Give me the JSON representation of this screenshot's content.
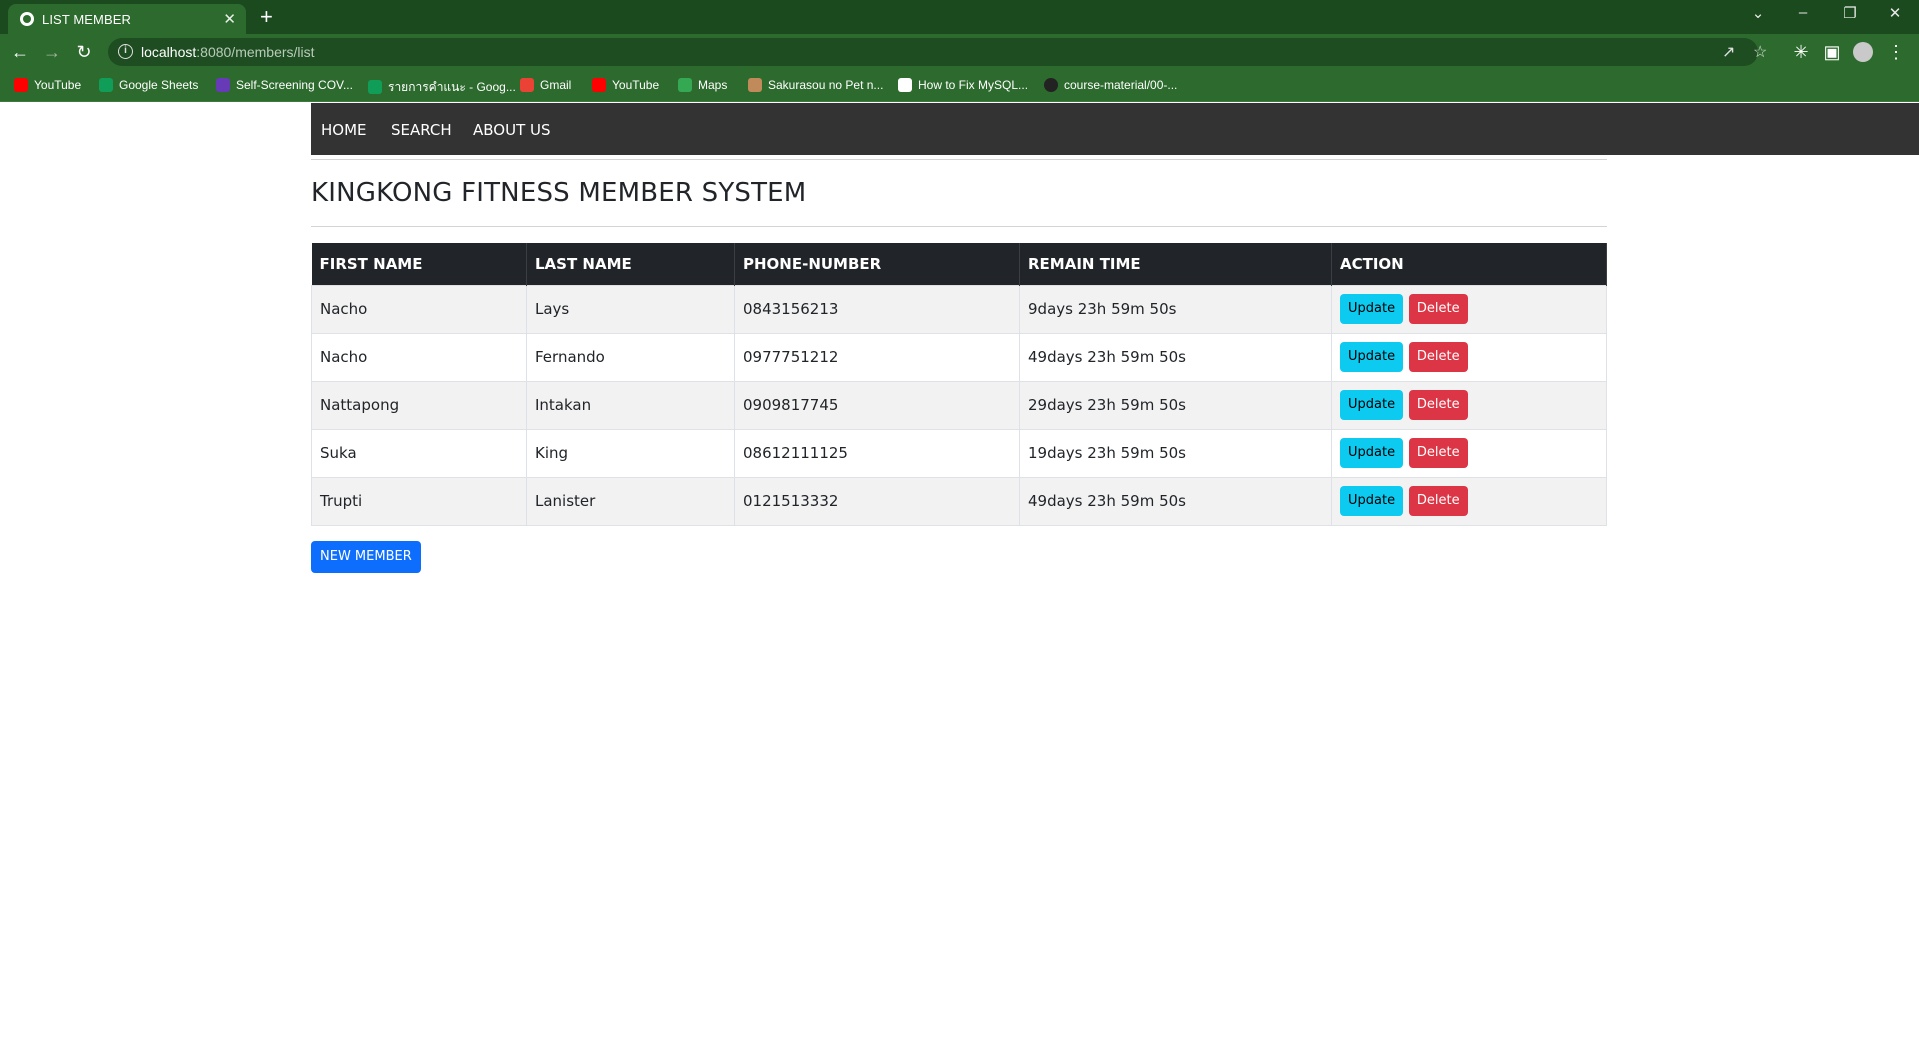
{
  "browser": {
    "tab_title": "LIST MEMBER",
    "tab_close": "✕",
    "new_tab": "+",
    "url_host": "localhost",
    "url_path": ":8080/members/list",
    "window_controls": {
      "tabs_menu": "⌄",
      "minimize": "–",
      "restore": "❐",
      "close": "✕"
    },
    "bookmarks": [
      {
        "label": "YouTube",
        "icon": "youtube-icon",
        "color": "#ff0000"
      },
      {
        "label": "Google Sheets",
        "icon": "sheets-icon",
        "color": "#0f9d58"
      },
      {
        "label": "Self-Screening COV...",
        "icon": "forms-icon",
        "color": "#673ab7"
      },
      {
        "label": "รายการคำแนะ - Goog...",
        "icon": "sheets-icon",
        "color": "#0f9d58"
      },
      {
        "label": "Gmail",
        "icon": "gmail-icon",
        "color": "#ea4335"
      },
      {
        "label": "YouTube",
        "icon": "youtube-icon",
        "color": "#ff0000"
      },
      {
        "label": "Maps",
        "icon": "maps-icon",
        "color": "#34a853"
      },
      {
        "label": "Sakurasou no Pet n...",
        "icon": "site-icon",
        "color": "#c08a5a"
      },
      {
        "label": "How to Fix MySQL...",
        "icon": "page-icon",
        "color": "#ffffff"
      },
      {
        "label": "course-material/00-...",
        "icon": "github-icon",
        "color": "#222222"
      }
    ]
  },
  "nav": {
    "home": "HOME",
    "search": "SEARCH",
    "about": "ABOUT US"
  },
  "page": {
    "heading": "KINGKONG FITNESS MEMBER SYSTEM",
    "new_member_label": "NEW MEMBER"
  },
  "table": {
    "headers": [
      "FIRST NAME",
      "LAST NAME",
      "PHONE-NUMBER",
      "REMAIN TIME",
      "ACTION"
    ],
    "update_label": "Update",
    "delete_label": "Delete",
    "rows": [
      [
        "Nacho",
        "Lays",
        "0843156213",
        "9days 23h 59m 50s"
      ],
      [
        "Nacho",
        "Fernando",
        "0977751212",
        "49days 23h 59m 50s"
      ],
      [
        "Nattapong",
        "Intakan",
        "0909817745",
        "29days 23h 59m 50s"
      ],
      [
        "Suka",
        "King",
        "08612111125",
        "19days 23h 59m 50s"
      ],
      [
        "Trupti",
        "Lanister",
        "0121513332",
        "49days 23h 59m 50s"
      ]
    ]
  },
  "colors": {
    "chrome_dark": "#1a4a1d",
    "chrome": "#2d6a2e",
    "nav_bg": "#333333",
    "table_head": "#212529",
    "update_btn": "#0dcaf0",
    "delete_btn": "#dc3545",
    "primary_btn": "#0d6efd"
  }
}
